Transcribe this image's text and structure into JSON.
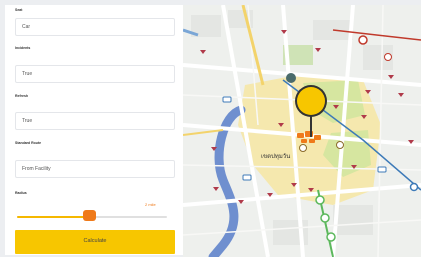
{
  "form": {
    "fields": [
      {
        "label": "Seat",
        "value": "Car"
      },
      {
        "label": "Incidents",
        "value": "True"
      },
      {
        "label": "Refresh",
        "value": "True"
      },
      {
        "label": "Standard Route",
        "value": "From Facility"
      }
    ],
    "slider": {
      "label": "Radius",
      "value_text": "2 mile",
      "level": 0.48
    },
    "calculate_label": "Calculate"
  },
  "map": {
    "district_label": "เขตปทุมวัน",
    "colors": {
      "marker": "#f7c600",
      "marker_stem": "#333333",
      "area_yellow": "#f5e7a6",
      "area_green": "#d6e6a0",
      "river": "#6f8fcf",
      "orange_cluster": "#ef7a1a",
      "transit_green": "#5cb85c"
    }
  }
}
